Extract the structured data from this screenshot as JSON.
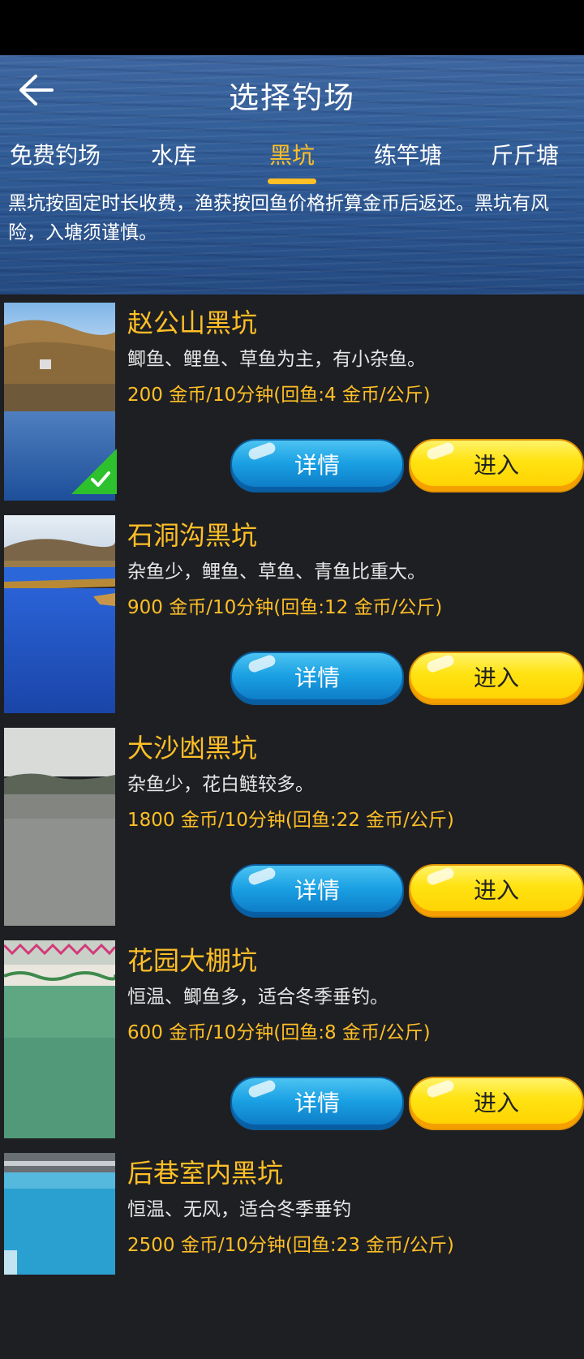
{
  "header": {
    "title": "选择钓场",
    "tabs": [
      {
        "label": "免费钓场",
        "active": false
      },
      {
        "label": "水库",
        "active": false
      },
      {
        "label": "黑坑",
        "active": true
      },
      {
        "label": "练竿塘",
        "active": false
      },
      {
        "label": "斤斤塘",
        "active": false
      }
    ],
    "notice": "黑坑按固定时长收费，渔获按回鱼价格折算金币后返还。黑坑有风险，入塘须谨慎。"
  },
  "buttons": {
    "detail": "详情",
    "enter": "进入"
  },
  "ponds": [
    {
      "name": "赵公山黑坑",
      "desc": "鲫鱼、鲤鱼、草鱼为主，有小杂鱼。",
      "price": "200 金币/10分钟(回鱼:4 金币/公斤)",
      "selected": true
    },
    {
      "name": "石洞沟黑坑",
      "desc": "杂鱼少，鲤鱼、草鱼、青鱼比重大。",
      "price": "900 金币/10分钟(回鱼:12 金币/公斤)",
      "selected": false
    },
    {
      "name": "大沙凼黑坑",
      "desc": "杂鱼少，花白鲢较多。",
      "price": "1800 金币/10分钟(回鱼:22 金币/公斤)",
      "selected": false
    },
    {
      "name": "花园大棚坑",
      "desc": "恒温、鲫鱼多，适合冬季垂钓。",
      "price": "600 金币/10分钟(回鱼:8 金币/公斤)",
      "selected": false
    },
    {
      "name": "后巷室内黑坑",
      "desc": "恒温、无风，适合冬季垂钓",
      "price": "2500 金币/10分钟(回鱼:23 金币/公斤)",
      "selected": false
    }
  ],
  "colors": {
    "accent": "#ffbf26",
    "background": "#1e1f23",
    "detail_button": "#1aa0e3",
    "enter_button": "#ffe312",
    "check": "#2ec12e"
  }
}
